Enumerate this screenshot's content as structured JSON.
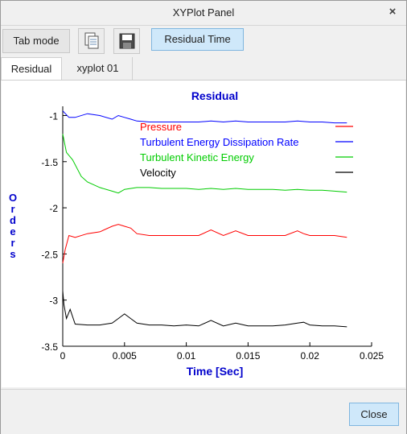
{
  "window": {
    "title": "XYPlot Panel",
    "close_glyph": "×"
  },
  "toolbar": {
    "tab_mode_label": "Tab mode",
    "copy_icon": "copy-icon",
    "save_icon": "save-icon",
    "residual_time_label": "Residual Time"
  },
  "tabs": [
    {
      "label": "Residual",
      "active": true
    },
    {
      "label": "xyplot 01",
      "active": false
    }
  ],
  "footer": {
    "close_label": "Close"
  },
  "colors": {
    "title_blue": "#0000cc",
    "pressure": "#ff0000",
    "ted_rate": "#0000ff",
    "tke": "#00cc00",
    "velocity": "#000000"
  },
  "chart_data": {
    "type": "line",
    "title": "Residual",
    "xlabel": "Time [Sec]",
    "ylabel": "Orders",
    "xlim": [
      0,
      0.025
    ],
    "ylim": [
      -3.5,
      -0.9
    ],
    "x_ticks": [
      "0",
      "0.005",
      "0.01",
      "0.015",
      "0.02",
      "0.025"
    ],
    "y_ticks": [
      "-1",
      "-1.5",
      "-2",
      "-2.5",
      "-3",
      "-3.5"
    ],
    "legend_placement": "top-right",
    "series": [
      {
        "name": "Pressure",
        "color": "#ff0000",
        "x": [
          0,
          0.0002,
          0.0005,
          0.001,
          0.002,
          0.003,
          0.004,
          0.0045,
          0.005,
          0.0055,
          0.006,
          0.007,
          0.008,
          0.009,
          0.01,
          0.011,
          0.012,
          0.013,
          0.014,
          0.015,
          0.016,
          0.017,
          0.018,
          0.019,
          0.0195,
          0.02,
          0.021,
          0.022,
          0.023
        ],
        "y": [
          -2.6,
          -2.45,
          -2.3,
          -2.32,
          -2.28,
          -2.26,
          -2.2,
          -2.18,
          -2.2,
          -2.22,
          -2.28,
          -2.3,
          -2.3,
          -2.3,
          -2.3,
          -2.3,
          -2.24,
          -2.3,
          -2.25,
          -2.3,
          -2.3,
          -2.3,
          -2.3,
          -2.25,
          -2.28,
          -2.3,
          -2.3,
          -2.3,
          -2.32
        ]
      },
      {
        "name": "Turbulent Energy Dissipation Rate",
        "color": "#0000ff",
        "x": [
          0,
          0.0005,
          0.001,
          0.002,
          0.003,
          0.004,
          0.0045,
          0.005,
          0.0055,
          0.006,
          0.007,
          0.008,
          0.009,
          0.01,
          0.011,
          0.012,
          0.013,
          0.014,
          0.015,
          0.016,
          0.017,
          0.018,
          0.019,
          0.02,
          0.021,
          0.022,
          0.023
        ],
        "y": [
          -0.95,
          -1.02,
          -1.02,
          -0.98,
          -1.0,
          -1.04,
          -1.0,
          -1.02,
          -1.04,
          -1.06,
          -1.07,
          -1.07,
          -1.07,
          -1.07,
          -1.07,
          -1.06,
          -1.07,
          -1.06,
          -1.07,
          -1.07,
          -1.07,
          -1.07,
          -1.06,
          -1.07,
          -1.07,
          -1.08,
          -1.08
        ]
      },
      {
        "name": "Turbulent Kinetic Energy",
        "color": "#00cc00",
        "x": [
          0,
          0.0003,
          0.0008,
          0.0015,
          0.002,
          0.003,
          0.004,
          0.0045,
          0.005,
          0.006,
          0.007,
          0.008,
          0.009,
          0.01,
          0.011,
          0.012,
          0.013,
          0.014,
          0.015,
          0.016,
          0.017,
          0.018,
          0.019,
          0.02,
          0.021,
          0.022,
          0.023
        ],
        "y": [
          -1.2,
          -1.4,
          -1.48,
          -1.66,
          -1.72,
          -1.78,
          -1.82,
          -1.84,
          -1.8,
          -1.78,
          -1.78,
          -1.79,
          -1.79,
          -1.79,
          -1.8,
          -1.79,
          -1.8,
          -1.79,
          -1.8,
          -1.8,
          -1.8,
          -1.81,
          -1.8,
          -1.81,
          -1.81,
          -1.82,
          -1.83
        ]
      },
      {
        "name": "Velocity",
        "color": "#000000",
        "x": [
          0,
          0.0001,
          0.0003,
          0.0006,
          0.001,
          0.002,
          0.003,
          0.004,
          0.0045,
          0.005,
          0.0055,
          0.006,
          0.007,
          0.008,
          0.009,
          0.01,
          0.011,
          0.012,
          0.013,
          0.014,
          0.015,
          0.016,
          0.017,
          0.018,
          0.019,
          0.0195,
          0.02,
          0.021,
          0.022,
          0.023
        ],
        "y": [
          -2.9,
          -3.05,
          -3.2,
          -3.1,
          -3.26,
          -3.27,
          -3.27,
          -3.25,
          -3.2,
          -3.15,
          -3.2,
          -3.25,
          -3.27,
          -3.27,
          -3.28,
          -3.27,
          -3.28,
          -3.22,
          -3.28,
          -3.25,
          -3.28,
          -3.28,
          -3.28,
          -3.27,
          -3.25,
          -3.24,
          -3.27,
          -3.28,
          -3.28,
          -3.29
        ]
      }
    ]
  }
}
